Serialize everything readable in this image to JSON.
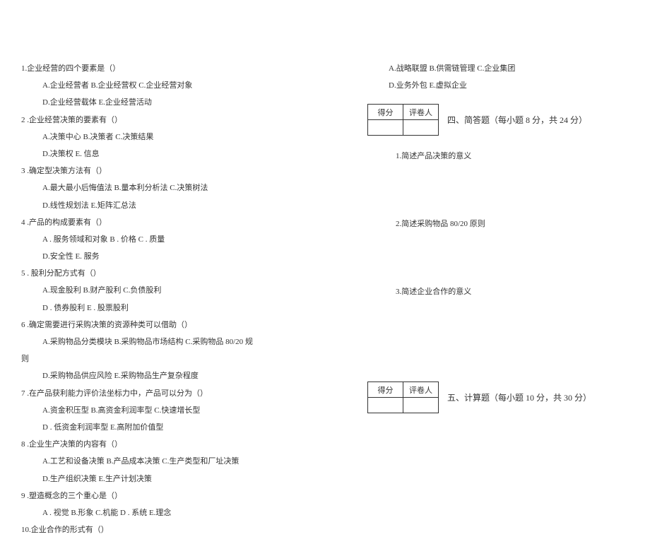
{
  "left": {
    "q1": "1.企业经营的四个要素是（）",
    "q1a": "A.企业经营者 B.企业经营权 C.企业经营对象",
    "q1b": "D.企业经营载体 E.企业经营活动",
    "q2": "2 .企业经营决策的要素有（）",
    "q2a": "A.决策中心 B.决策者 C.决策结果",
    "q2b": "D.决策权 E. 信息",
    "q3": "3 .确定型决策方法有（）",
    "q3a": "A.最大最小后悔值法 B.量本利分析法 C.决策树法",
    "q3b": "D.线性规划法 E.矩阵汇总法",
    "q4": "4 .产品的构成要素有（）",
    "q4a": "A . 服务领域和对象 B . 价格  C . 质量",
    "q4b": "D.安全性 E. 服务",
    "q5": "5 . 股利分配方式有（）",
    "q5a": "A.现金股利 B.财产股利 C.负债股利",
    "q5b": "D . 债券股利 E . 股票股利",
    "q6": "6 .确定需要进行采购决策的资源种类可以借助（）",
    "q6a": "A.采购物品分类模块 B.采购物品市场结构 C.采购物品 80/20 规",
    "q6r": "则",
    "q6b": "D.采购物品供应风险 E.采购物品生产复杂程度",
    "q7": "7 .在产品获利能力评价法坐标力中，产品可以分为（）",
    "q7a": "A.资金积压型  B.高资金利润率型 C.快速增长型",
    "q7b": "D . 低资金利润率型 E.高附加价值型",
    "q8": "8 .企业生产决策的内容有（）",
    "q8a": "A.工艺和设备决策 B.产品成本决策 C.生产类型和厂址决策",
    "q8b": "D.生产组织决策 E.生产计划决策",
    "q9": "9 .塑造概念的三个重心是（）",
    "q9a": "A . 视觉  B.形象  C.机能  D . 系统  E.理念",
    "q10": "10.企业合作的形式有（）"
  },
  "right": {
    "q10a": "A.战略联盟  B.供需链管理 C.企业集团",
    "q10b": "D.业务外包  E.虚拟企业",
    "scoreH1": "得分",
    "scoreH2": "评卷人",
    "section4": "四、简答题（每小题 8 分，共 24 分）",
    "sq1": "1.简述产品决策的意义",
    "sq2": "2.简述采购物品 80/20 原则",
    "sq3": "3.简述企业合作的意义",
    "section5": "五、计算题（每小题   10 分，共 30 分）"
  }
}
